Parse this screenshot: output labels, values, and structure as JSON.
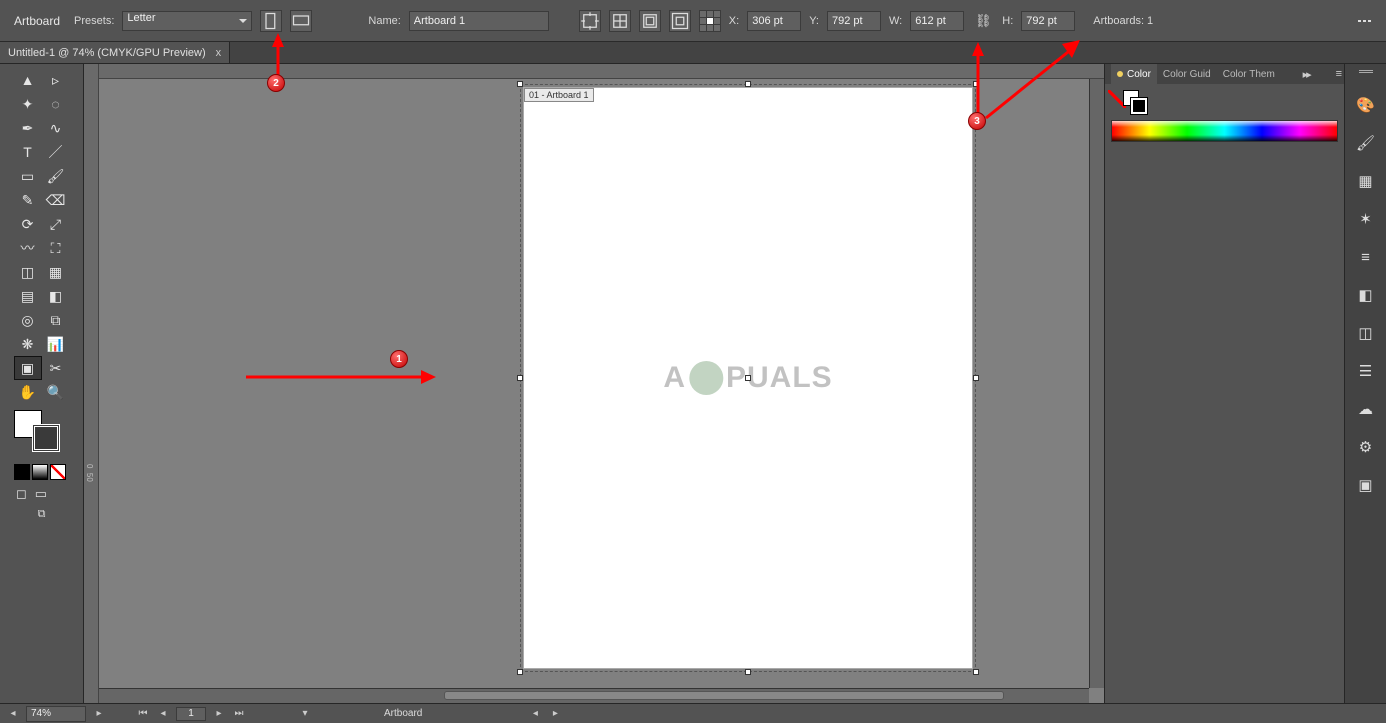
{
  "control_bar": {
    "mode_label": "Artboard",
    "presets_label": "Presets:",
    "preset_value": "Letter",
    "orientation_portrait_icon": "portrait-icon",
    "orientation_landscape_icon": "landscape-icon",
    "name_label": "Name:",
    "name_value": "Artboard 1",
    "x_label": "X:",
    "x_value": "306 pt",
    "y_label": "Y:",
    "y_value": "792 pt",
    "w_label": "W:",
    "w_value": "612 pt",
    "h_label": "H:",
    "h_value": "792 pt",
    "constrain_icon": "link-icon",
    "artboards_label": "Artboards: 1"
  },
  "doc_tab": {
    "title": "Untitled-1 @ 74% (CMYK/GPU Preview)",
    "close": "x"
  },
  "artboard": {
    "label": "01 - Artboard 1"
  },
  "watermark_text_left": "A",
  "watermark_text_right": "PUALS",
  "panels": {
    "color_tab": "Color",
    "guide_tab": "Color Guid",
    "themes_tab": "Color Them",
    "more": "▸▸"
  },
  "status": {
    "zoom": "74%",
    "page": "1",
    "tool_label": "Artboard"
  },
  "annotations": {
    "marker1": "1",
    "marker2": "2",
    "marker3": "3"
  },
  "left_tools": [
    "selection-tool",
    "direct-selection-tool",
    "magic-wand-tool",
    "lasso-tool",
    "pen-tool",
    "curvature-tool",
    "type-tool",
    "line-segment-tool",
    "rectangle-tool",
    "paintbrush-tool",
    "pencil-tool",
    "eraser-tool",
    "rotate-tool",
    "scale-tool",
    "width-tool",
    "free-transform-tool",
    "shape-builder-tool",
    "perspective-grid-tool",
    "mesh-tool",
    "gradient-tool",
    "eyedropper-tool",
    "blend-tool",
    "symbol-sprayer-tool",
    "column-graph-tool",
    "artboard-tool",
    "slice-tool",
    "hand-tool",
    "zoom-tool"
  ],
  "dock_icons": [
    "color-palette-icon",
    "brushes-icon",
    "swatches-icon",
    "symbols-icon",
    "stroke-icon",
    "appearance-icon",
    "graphic-styles-icon",
    "layers-icon",
    "libraries-icon",
    "properties-icon",
    "artboards-panel-icon"
  ]
}
